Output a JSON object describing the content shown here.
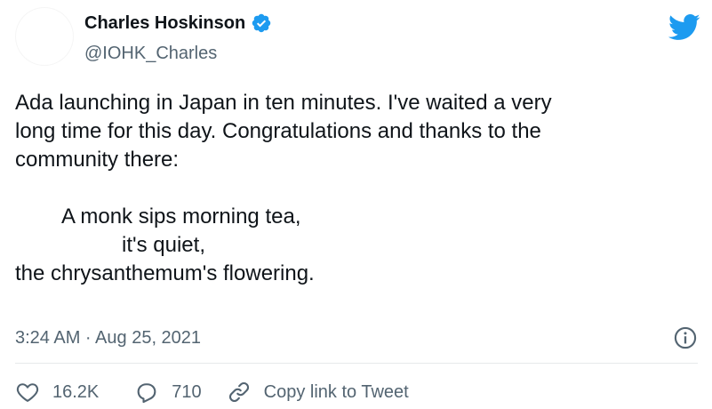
{
  "author": {
    "display_name": "Charles Hoskinson",
    "handle": "@IOHK_Charles",
    "verified": true
  },
  "tweet": {
    "lines": [
      "Ada launching in Japan in ten minutes. I've waited a very",
      "long time for this day. Congratulations and thanks to the",
      "community there:",
      "",
      "        A monk sips morning tea,",
      "                  it's quiet,",
      "the chrysanthemum's flowering."
    ],
    "timestamp": "3:24 AM · Aug 25, 2021"
  },
  "actions": {
    "likes": "16.2K",
    "replies": "710",
    "copy_link_label": "Copy link to Tweet"
  },
  "colors": {
    "brand": "#1d9bf0",
    "text_primary": "#0f1419",
    "text_secondary": "#536471",
    "divider": "#e7e9ea"
  },
  "icons": {
    "brand": "twitter-bird-icon",
    "verified": "verified-badge-icon",
    "info": "info-icon",
    "like": "heart-icon",
    "reply": "reply-bubble-icon",
    "copy": "link-icon"
  }
}
